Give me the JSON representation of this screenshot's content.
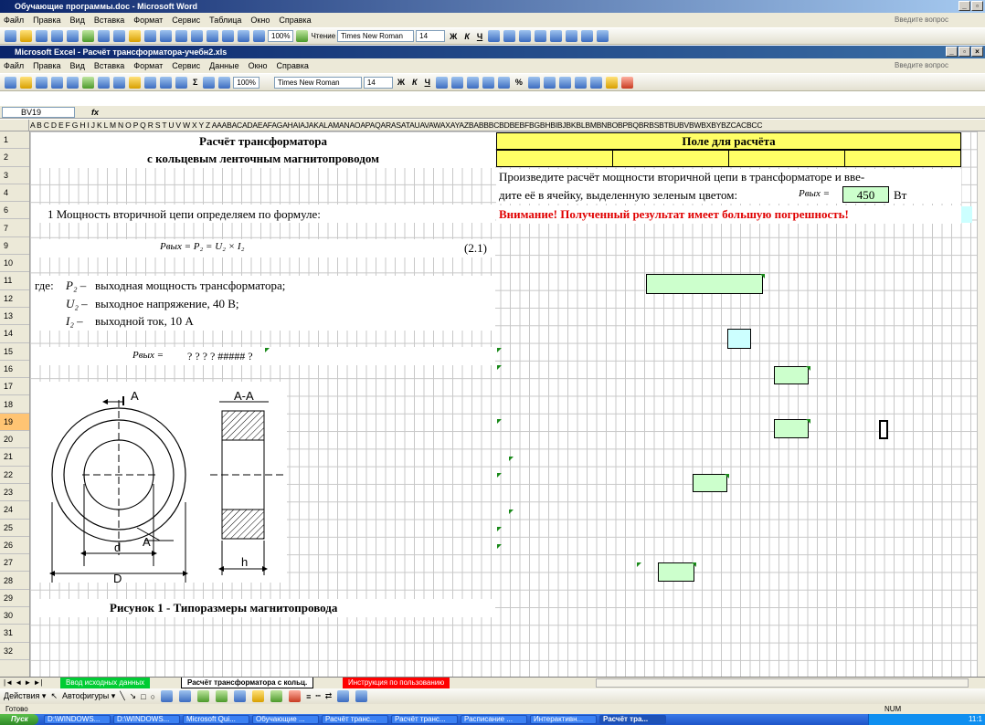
{
  "word": {
    "title": "Обучающие программы.doc - Microsoft Word",
    "menu": [
      "Файл",
      "Правка",
      "Вид",
      "Вставка",
      "Формат",
      "Сервис",
      "Таблица",
      "Окно",
      "Справка"
    ],
    "help_placeholder": "Введите вопрос",
    "zoom": "100%",
    "reading": "Чтение",
    "font": "Times New Roman",
    "size": "14"
  },
  "excel": {
    "title": "Microsoft Excel - Расчёт трансформатора-учебн2.xls",
    "menu": [
      "Файл",
      "Правка",
      "Вид",
      "Вставка",
      "Формат",
      "Сервис",
      "Данные",
      "Окно",
      "Справка"
    ],
    "help_placeholder": "Введите вопрос",
    "zoom": "100%",
    "font": "Times New Roman",
    "size": "14",
    "name_box": "BV19",
    "fx": "fx"
  },
  "col_letters": "A B C D E F G H I J K L M N O P Q R S T U V W X Y Z AAABACADAEAFAGAHAIAJAKALAMANAOAPAQARASATAUAVAWAXAYAZBABBBCBDBEBFBGBHBIBJBKBLBMBNBOBPBQBRBSBTBUBVBWBXBYBZCACBCC",
  "rows": [
    "1",
    "2",
    "3",
    "4",
    "6",
    "7",
    "9",
    "10",
    "11",
    "12",
    "13",
    "14",
    "15",
    "16",
    "17",
    "18",
    "19",
    "20",
    "21",
    "22",
    "23",
    "24",
    "25",
    "26",
    "27",
    "28",
    "29",
    "30",
    "31",
    "32"
  ],
  "selected_row": "19",
  "sheet": {
    "title1": "Расчёт трансформатора",
    "title2": "с кольцевым ленточным магнитопроводом",
    "calc_field": "Поле для расчёта",
    "instr1": "Произведите расчёт мощности вторичной цепи в трансформаторе и вве-",
    "instr2": "дите её в ячейку, выделенную зеленым цветом:",
    "pvyx_label": "Pвых =",
    "pvyx_value": "450",
    "unit": "Вт",
    "warning": "Внимание! Полученный результат имеет большую погрешность!",
    "step1": "1 Мощность вторичной цепи определяем по формуле:",
    "formula": "Pвых = P₂ = U₂ × I₂",
    "formula_num": "(2.1)",
    "where": "где:",
    "p2": "P₂ –",
    "p2_text": "выходная мощность трансформатора;",
    "u2": "U₂ –",
    "u2_text": "выходное напряжение, 40 В;",
    "i2": "I₂ –",
    "i2_text": "выходной ток, 10 А",
    "calc_line_label": "Pвых =",
    "calc_line_vals": "?    ?    ?    ? #####  ?",
    "figure_caption": "Рисунок 1 - Типоразмеры магнитопровода",
    "fig_labels": {
      "A": "А",
      "AA": "А-А",
      "d": "d",
      "D": "D",
      "h": "h",
      "A2": "А"
    }
  },
  "tabs": [
    "Ввод исходных данных",
    "Расчёт трансформатора с кольц.",
    "Инструкция по пользованию"
  ],
  "draw": {
    "actions": "Действия ▾",
    "autoshapes": "Автофигуры ▾"
  },
  "status": {
    "left": "Готово",
    "num": "NUM"
  },
  "taskbar": {
    "start": "Пуск",
    "buttons": [
      "D:\\WINDOWS...",
      "D:\\WINDOWS...",
      "Microsoft Qui...",
      "Обучающие ...",
      "Расчёт транс...",
      "Расчёт транс...",
      "Расписание ...",
      "Интерактивн...",
      "Расчёт тра..."
    ],
    "clock": "11:1"
  }
}
